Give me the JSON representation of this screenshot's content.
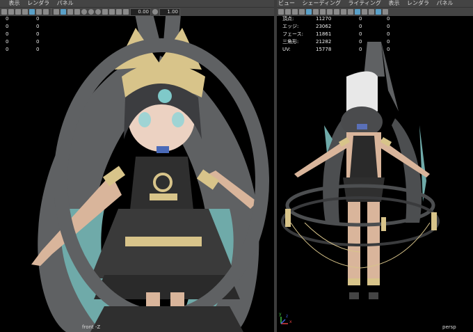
{
  "left_view": {
    "menu": [
      "表示",
      "レンダラ",
      "パネル"
    ],
    "hud_rows": [
      [
        "0",
        "0"
      ],
      [
        "0",
        "0"
      ],
      [
        "0",
        "0"
      ],
      [
        "0",
        "0"
      ],
      [
        "0",
        "0"
      ]
    ],
    "label": "front -Z"
  },
  "right_view": {
    "menu": [
      "ビュー",
      "シェーディング",
      "ライティング",
      "表示",
      "レンダラ",
      "パネル"
    ],
    "toolbar": {
      "value_a": "0.00",
      "value_b": "1.00"
    },
    "hud": [
      {
        "label": "頂点:",
        "v1": "11270",
        "v2": "0",
        "v3": "0"
      },
      {
        "label": "エッジ:",
        "v1": "23062",
        "v2": "0",
        "v3": "0"
      },
      {
        "label": "フェース:",
        "v1": "11861",
        "v2": "0",
        "v3": "0"
      },
      {
        "label": "三角形:",
        "v1": "21282",
        "v2": "0",
        "v3": "0"
      },
      {
        "label": "UV:",
        "v1": "15778",
        "v2": "0",
        "v3": "0"
      }
    ],
    "label": "persp",
    "axis": {
      "x": "x",
      "y": "y",
      "z": "z"
    }
  },
  "colors": {
    "panel_bg": "#000000",
    "menu_bg": "#444444",
    "hair_gray": "#5f6163",
    "hair_teal": "#7fb8b8",
    "gold": "#d8c48a",
    "skin": "#d9b59b",
    "dress": "#2f2f2f"
  }
}
